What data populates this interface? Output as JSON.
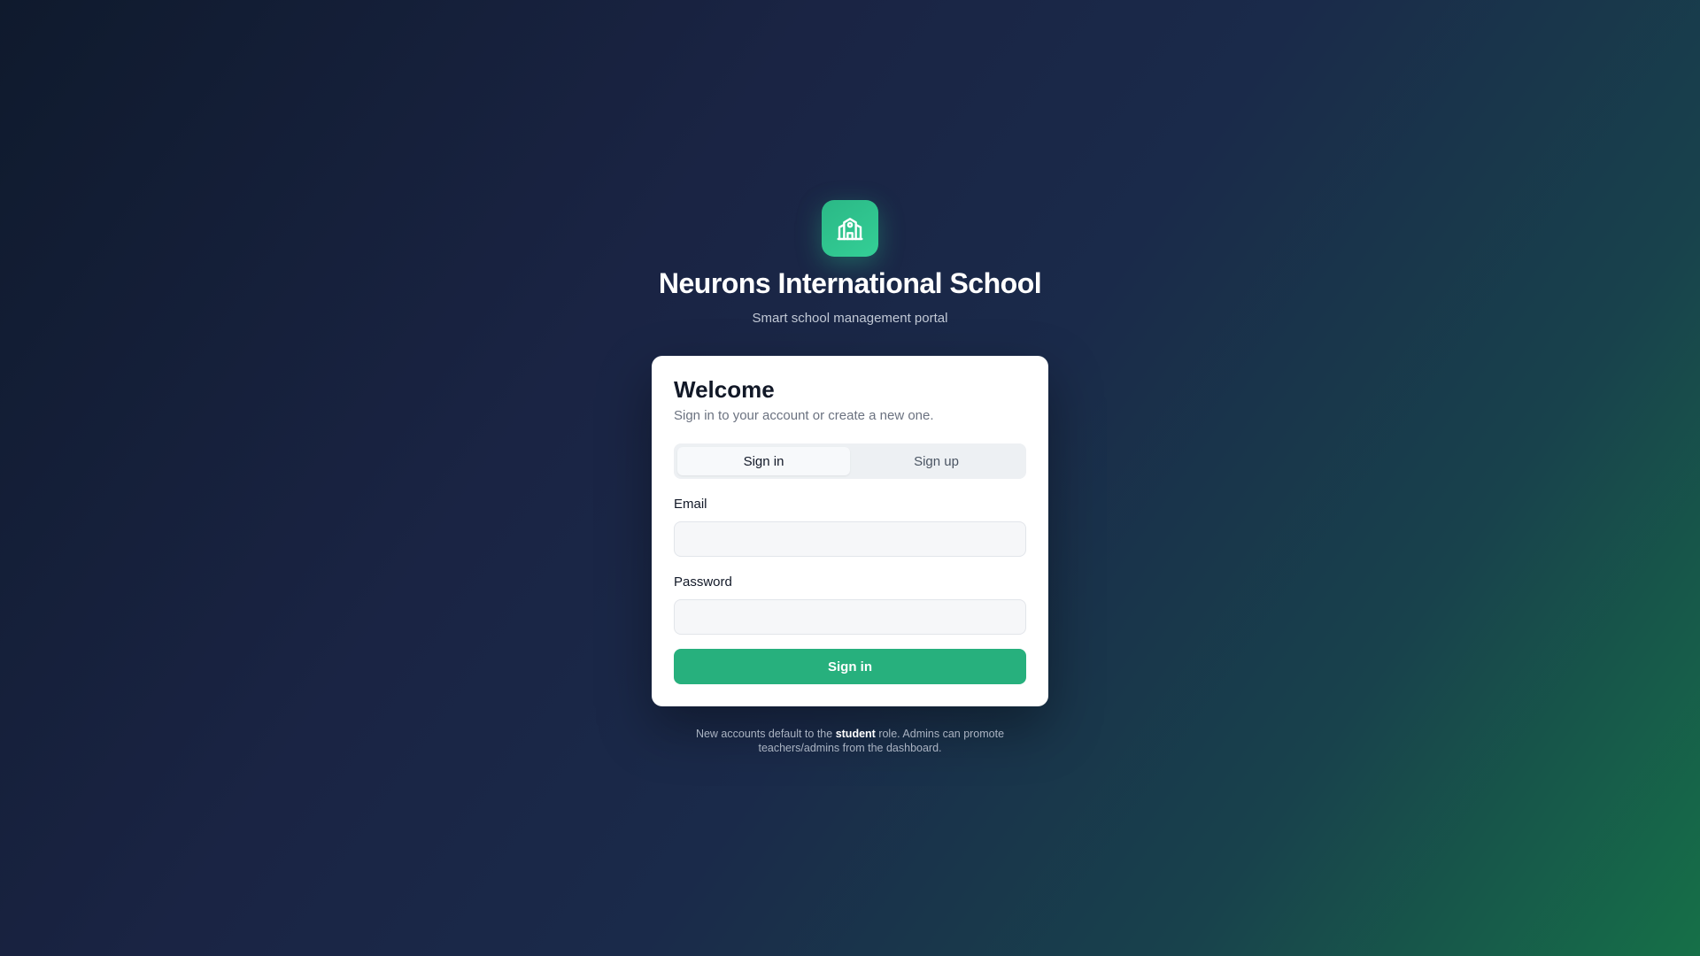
{
  "brand": {
    "logo_icon": "school-building-icon",
    "title": "Neurons International School",
    "subtitle": "Smart school management portal",
    "accent_color": "#2bb886"
  },
  "card": {
    "title": "Welcome",
    "description": "Sign in to your account or create a new one.",
    "tabs": [
      {
        "label": "Sign in",
        "active": true
      },
      {
        "label": "Sign up",
        "active": false
      }
    ],
    "email": {
      "label": "Email",
      "value": "",
      "placeholder": ""
    },
    "password": {
      "label": "Password",
      "value": "",
      "placeholder": ""
    },
    "submit_label": "Sign in",
    "button_color": "#27b07d"
  },
  "footnote": {
    "prefix": "New accounts default to the",
    "role": "student",
    "suffix": "role. Admins can promote teachers/admins from the dashboard."
  }
}
